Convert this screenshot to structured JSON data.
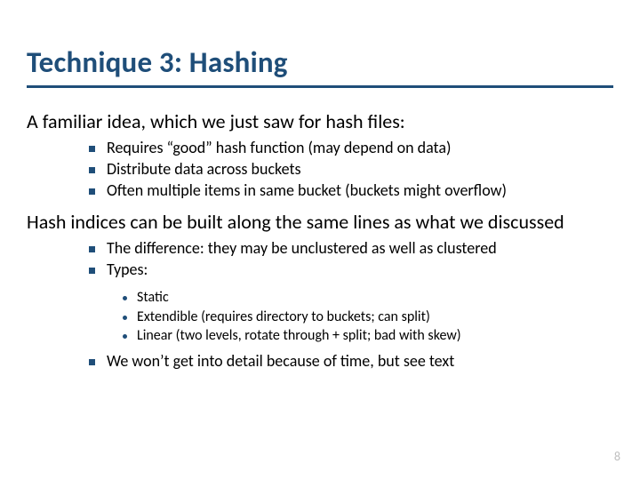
{
  "title": "Technique 3:  Hashing",
  "intro1": "A familiar idea, which we just saw for hash files:",
  "bullets1": [
    "Requires “good” hash function (may depend on data)",
    "Distribute data across buckets",
    "Often multiple items in same bucket (buckets might overflow)"
  ],
  "intro2": "Hash indices can be built along the same lines as what we discussed",
  "bullets2a": "The difference: they may be unclustered as well as clustered",
  "bullets2b": "Types:",
  "subTypes": [
    "Static",
    "Extendible (requires directory to buckets; can split)",
    "Linear (two levels, rotate through + split; bad with skew)"
  ],
  "bullets2c": "We won’t get into detail because of time, but see text",
  "pageNumber": "8"
}
